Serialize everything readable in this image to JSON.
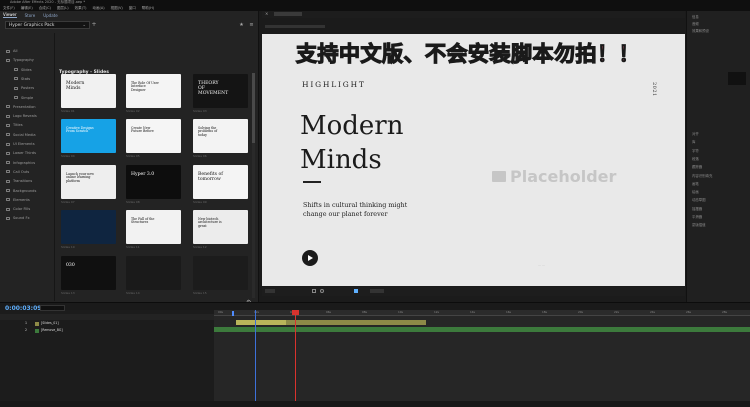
{
  "titlebar": {
    "title": "Adobe After Effects 2020 - 无标题项目.aep *"
  },
  "menu": [
    "文件(F)",
    "编辑(E)",
    "合成(C)",
    "图层(L)",
    "效果(T)",
    "动画(A)",
    "视图(V)",
    "窗口",
    "帮助(H)"
  ],
  "plugin": {
    "tabs": [
      "Viewer",
      "Store",
      "Update"
    ],
    "active_tab": "Viewer",
    "pack": "Hyper Graphics Pack",
    "section_title": "Typography - Slides",
    "categories": [
      {
        "label": "All",
        "sub": false
      },
      {
        "label": "Typography",
        "sub": false
      },
      {
        "label": "Slides",
        "sub": true
      },
      {
        "label": "Stats",
        "sub": true
      },
      {
        "label": "Posters",
        "sub": true
      },
      {
        "label": "Simple",
        "sub": true
      },
      {
        "label": "Presentation",
        "sub": false
      },
      {
        "label": "Logo Reveals",
        "sub": false
      },
      {
        "label": "Titles",
        "sub": false
      },
      {
        "label": "Social Media",
        "sub": false
      },
      {
        "label": "UI Elements",
        "sub": false
      },
      {
        "label": "Lower Thirds",
        "sub": false
      },
      {
        "label": "Infographics",
        "sub": false
      },
      {
        "label": "Call Outs",
        "sub": false
      },
      {
        "label": "Transitions",
        "sub": false
      },
      {
        "label": "Backgrounds",
        "sub": false
      },
      {
        "label": "Elements",
        "sub": false
      },
      {
        "label": "Color Fills",
        "sub": false
      },
      {
        "label": "Sound Fx",
        "sub": false
      }
    ],
    "thumbs": [
      {
        "title": "Modern Minds",
        "bg": "#f1f1f1",
        "fg": "#111",
        "label": "Slides 01"
      },
      {
        "title": "The Role Of User Interface Designer",
        "bg": "#f4f4f4",
        "fg": "#111",
        "label": "Slides 02"
      },
      {
        "title": "THEORY OF MOVEMENT",
        "bg": "#141414",
        "fg": "#f2f2f2",
        "label": "Slides 03"
      },
      {
        "title": "Creative Designs From Scratch",
        "bg": "#16a2e6",
        "fg": "#ffffff",
        "label": "Slides 04"
      },
      {
        "title": "Create New Future Before",
        "bg": "#f5f5f5",
        "fg": "#111",
        "label": "Slides 05"
      },
      {
        "title": "Solving the problems of today",
        "bg": "#f3f3f3",
        "fg": "#111",
        "label": "Slides 06"
      },
      {
        "title": "Launch your new online learning platform",
        "bg": "#eeeeee",
        "fg": "#111",
        "label": "Slides 07"
      },
      {
        "title": "Hyper 3.0",
        "bg": "#0d0d0d",
        "fg": "#ffffff",
        "label": "Slides 08"
      },
      {
        "title": "Benefits of tomorrow",
        "bg": "#f4f4f4",
        "fg": "#111",
        "label": "Slides 09"
      },
      {
        "title": "",
        "bg": "#0f2540",
        "fg": "#ffffff",
        "label": "Slides 10"
      },
      {
        "title": "The Fall of the Structures",
        "bg": "#f2f2f2",
        "fg": "#111",
        "label": "Slides 11"
      },
      {
        "title": "New biotech architecture is great",
        "bg": "#ececec",
        "fg": "#111",
        "label": "Slides 12"
      },
      {
        "title": "030",
        "bg": "#101010",
        "fg": "#ffffff",
        "label": "Slides 13"
      },
      {
        "title": "",
        "bg": "#1a1a1a",
        "fg": "#ffffff",
        "label": "Slides 14"
      },
      {
        "title": "",
        "bg": "#1c1c1c",
        "fg": "#ffffff",
        "label": "Slides 15"
      }
    ]
  },
  "slide": {
    "kicker": "HIGHLIGHT",
    "year": "2021",
    "title_line1": "Modern",
    "title_line2": "Minds",
    "subtitle_line1": "Shifts in cultural thinking might",
    "subtitle_line2": "change our planet forever",
    "placeholder": "Placeholder"
  },
  "banner": {
    "text": "支持中文版、不会安装脚本勿拍！！",
    "mark": "！"
  },
  "right_panel": [
    "信息",
    "音频",
    "效果和预设",
    "对齐",
    "库",
    "字符",
    "段落",
    "跟踪器",
    "内容识别填充",
    "画笔",
    "绘画",
    "动态草图",
    "摇摆器",
    "平滑器",
    "蒙版插值"
  ],
  "timeline": {
    "timecode": "0:00:03:09",
    "layers": [
      {
        "num": "1",
        "name": "[Slides_01]",
        "color": "#8d8a47"
      },
      {
        "num": "2",
        "name": "[Remove_BG]",
        "color": "#3c7a3c"
      }
    ],
    "ticks": [
      "00s",
      "02s",
      "04s",
      "06s",
      "08s",
      "10s",
      "12s",
      "14s",
      "16s",
      "18s",
      "20s",
      "22s",
      "24s",
      "26s",
      "28s"
    ]
  },
  "colors": {
    "accent": "#5fb0ff",
    "banner": "#ff6a86",
    "cti": "#d9332e"
  }
}
